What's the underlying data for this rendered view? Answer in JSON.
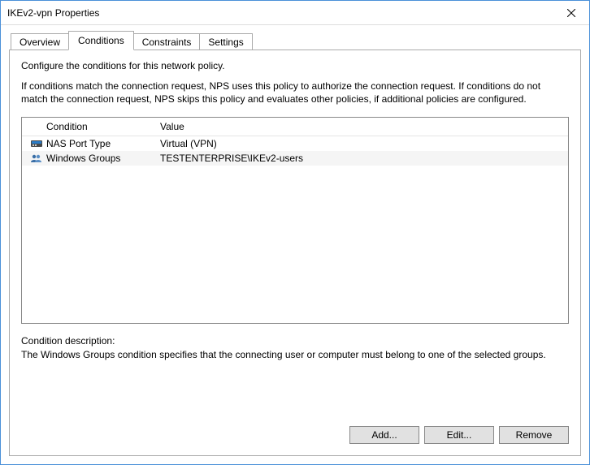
{
  "window": {
    "title": "IKEv2-vpn Properties"
  },
  "tabs": {
    "overview": "Overview",
    "conditions": "Conditions",
    "constraints": "Constraints",
    "settings": "Settings",
    "active": "conditions"
  },
  "panel": {
    "intro": "Configure the conditions for this network policy.",
    "sub": "If conditions match the connection request, NPS uses this policy to authorize the connection request. If conditions do not match the connection request, NPS skips this policy and evaluates other policies, if additional policies are configured."
  },
  "list": {
    "headers": {
      "condition": "Condition",
      "value": "Value"
    },
    "rows": [
      {
        "icon": "nas-port-type-icon",
        "condition": "NAS Port Type",
        "value": "Virtual (VPN)"
      },
      {
        "icon": "windows-groups-icon",
        "condition": "Windows Groups",
        "value": "TESTENTERPRISE\\IKEv2-users"
      }
    ]
  },
  "description": {
    "label": "Condition description:",
    "text": "The Windows Groups condition specifies that the connecting user or computer must belong to one of the selected groups."
  },
  "buttons": {
    "add": "Add...",
    "edit": "Edit...",
    "remove": "Remove"
  }
}
